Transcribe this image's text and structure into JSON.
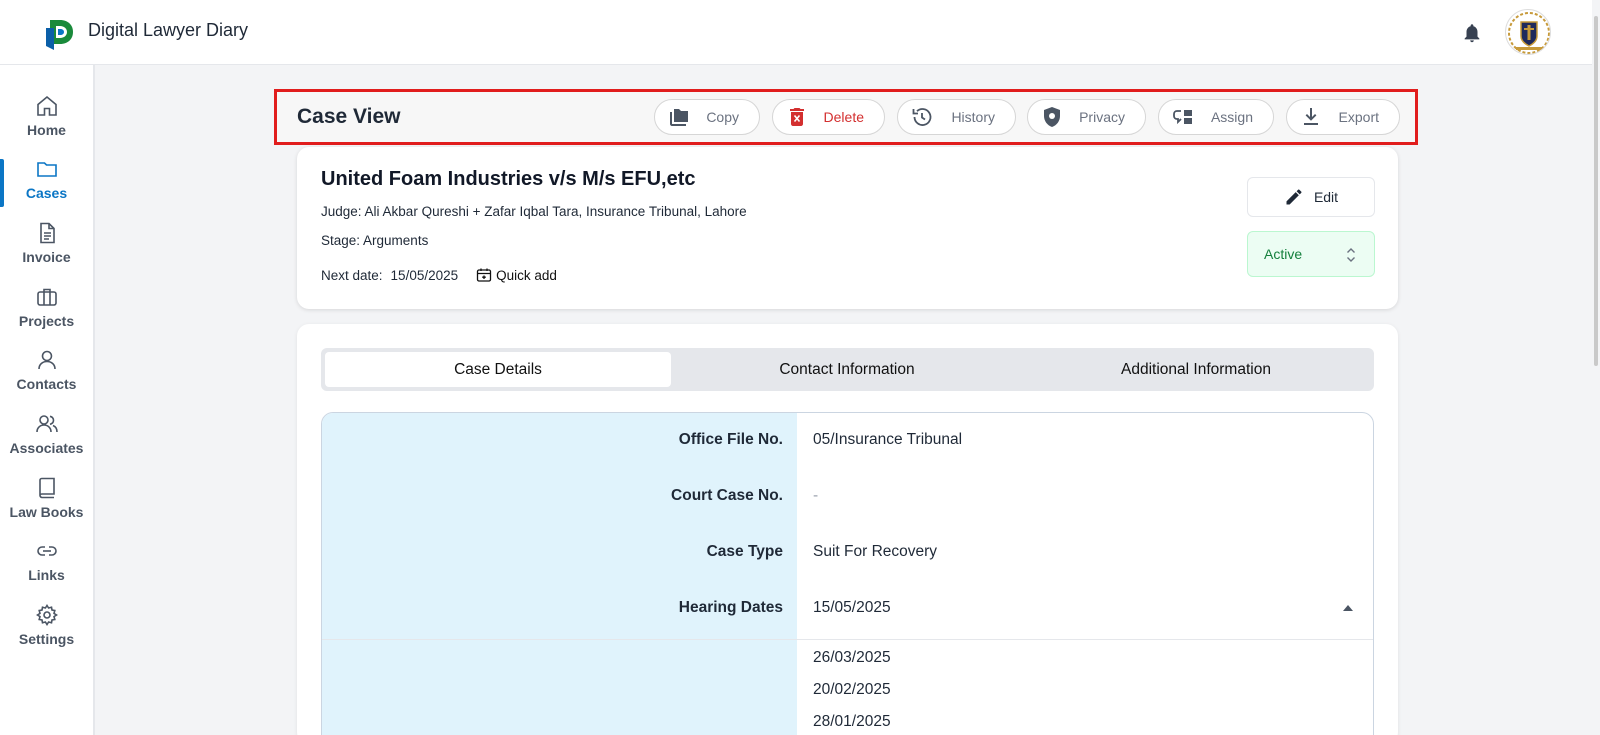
{
  "app": {
    "title": "Digital Lawyer Diary"
  },
  "colors": {
    "accent": "#0b76c5",
    "danger": "#d32f2f",
    "active_status": "#15803d",
    "highlight_border": "#e11d1d"
  },
  "sidebar": {
    "items": [
      {
        "label": "Home",
        "icon": "home-icon"
      },
      {
        "label": "Cases",
        "icon": "folder-icon",
        "active": true
      },
      {
        "label": "Invoice",
        "icon": "document-icon"
      },
      {
        "label": "Projects",
        "icon": "briefcase-icon"
      },
      {
        "label": "Contacts",
        "icon": "person-icon"
      },
      {
        "label": "Associates",
        "icon": "people-icon"
      },
      {
        "label": "Law Books",
        "icon": "book-icon"
      },
      {
        "label": "Links",
        "icon": "link-icon"
      },
      {
        "label": "Settings",
        "icon": "gear-icon"
      }
    ]
  },
  "toolbar": {
    "title": "Case View",
    "buttons": {
      "copy": "Copy",
      "delete": "Delete",
      "history": "History",
      "privacy": "Privacy",
      "assign": "Assign",
      "export": "Export"
    }
  },
  "case": {
    "title": "United Foam Industries v/s M/s EFU,etc",
    "judge": "Judge: Ali Akbar Qureshi + Zafar Iqbal Tara, Insurance Tribunal, Lahore",
    "stage": "Stage: Arguments",
    "next_date_label": "Next date:",
    "next_date": "15/05/2025",
    "quick_add": "Quick add",
    "edit_label": "Edit",
    "status": "Active"
  },
  "tabs": [
    "Case Details",
    "Contact Information",
    "Additional Information"
  ],
  "details": {
    "rows": [
      {
        "label": "Office File No.",
        "value": "05/Insurance Tribunal"
      },
      {
        "label": "Court Case No.",
        "value": "-"
      },
      {
        "label": "Case Type",
        "value": "Suit For Recovery"
      },
      {
        "label": "Hearing Dates",
        "value": "15/05/2025"
      }
    ],
    "more_hearing_dates": [
      "26/03/2025",
      "20/02/2025",
      "28/01/2025"
    ]
  }
}
